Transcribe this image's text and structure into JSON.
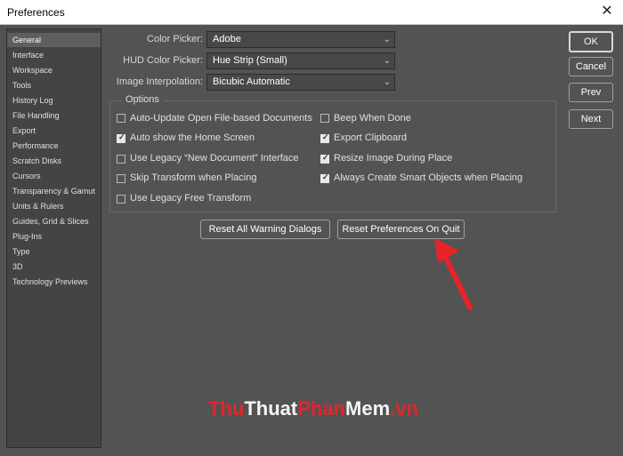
{
  "window": {
    "title": "Preferences",
    "close_symbol": "✕"
  },
  "sidebar": {
    "items": [
      {
        "label": "General",
        "selected": true
      },
      {
        "label": "Interface"
      },
      {
        "label": "Workspace"
      },
      {
        "label": "Tools"
      },
      {
        "label": "History Log"
      },
      {
        "label": "File Handling"
      },
      {
        "label": "Export"
      },
      {
        "label": "Performance"
      },
      {
        "label": "Scratch Disks"
      },
      {
        "label": "Cursors"
      },
      {
        "label": "Transparency & Gamut"
      },
      {
        "label": "Units & Rulers"
      },
      {
        "label": "Guides, Grid & Slices"
      },
      {
        "label": "Plug-Ins"
      },
      {
        "label": "Type"
      },
      {
        "label": "3D"
      },
      {
        "label": "Technology Previews"
      }
    ]
  },
  "fields": {
    "color_picker": {
      "label": "Color Picker:",
      "value": "Adobe"
    },
    "hud_color_picker": {
      "label": "HUD Color Picker:",
      "value": "Hue Strip (Small)"
    },
    "image_interpolation": {
      "label": "Image Interpolation:",
      "value": "Bicubic Automatic"
    }
  },
  "options": {
    "title": "Options",
    "left": [
      {
        "label": "Auto-Update Open File-based Documents",
        "checked": false
      },
      {
        "label": "Auto show the Home Screen",
        "checked": true
      },
      {
        "label": "Use Legacy “New Document” Interface",
        "checked": false
      },
      {
        "label": "Skip Transform when Placing",
        "checked": false
      },
      {
        "label": "Use Legacy Free Transform",
        "checked": false
      }
    ],
    "right": [
      {
        "label": "Beep When Done",
        "checked": false
      },
      {
        "label": "Export Clipboard",
        "checked": true
      },
      {
        "label": "Resize Image During Place",
        "checked": true
      },
      {
        "label": "Always Create Smart Objects when Placing",
        "checked": true
      }
    ]
  },
  "buttons": {
    "ok": "OK",
    "cancel": "Cancel",
    "prev": "Prev",
    "next": "Next",
    "reset_warnings": "Reset All Warning Dialogs",
    "reset_prefs": "Reset Preferences On Quit"
  },
  "watermark": {
    "parts": [
      "Thu",
      "Thuat",
      "Phan",
      "Mem",
      ".vn"
    ],
    "colors": [
      "#e8232a",
      "#f5f5f5",
      "#e8232a",
      "#f5f5f5",
      "#e8232a"
    ]
  },
  "colors": {
    "accent_arrow": "#e8232a",
    "background": "#535353"
  }
}
